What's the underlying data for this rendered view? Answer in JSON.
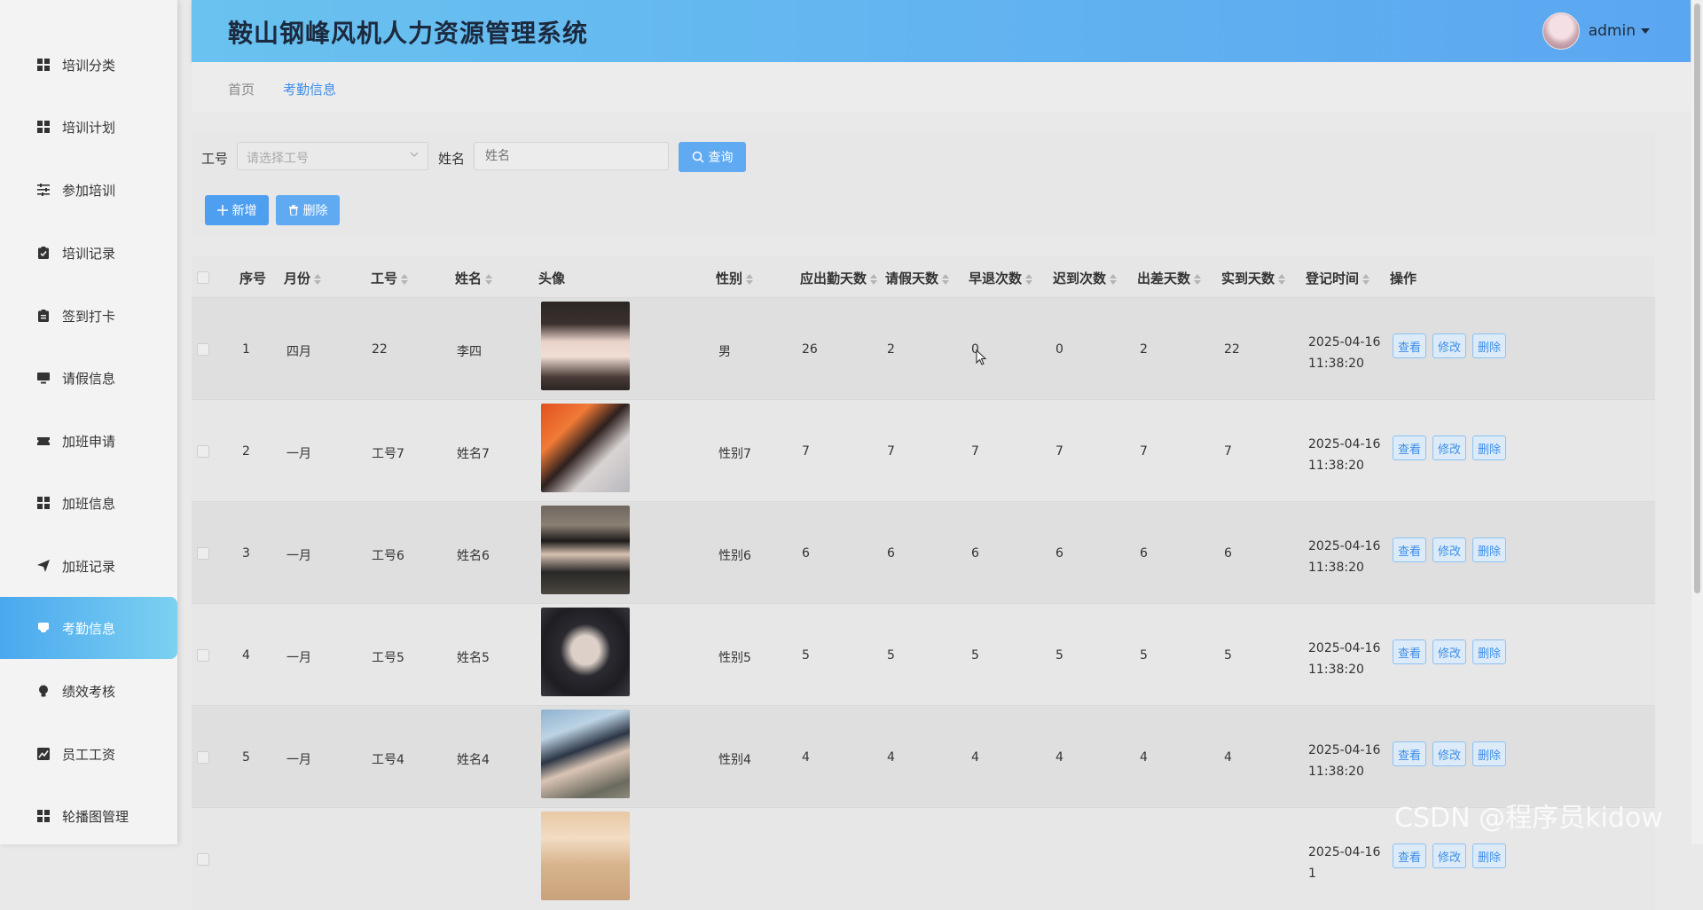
{
  "app": {
    "title": "鞍山钢峰风机人力资源管理系统",
    "username": "admin"
  },
  "sidebar": {
    "items": [
      {
        "label": "培训分类",
        "icon": "grid-icon"
      },
      {
        "label": "培训计划",
        "icon": "grid-icon"
      },
      {
        "label": "参加培训",
        "icon": "sliders-icon"
      },
      {
        "label": "培训记录",
        "icon": "clipboard-check-icon"
      },
      {
        "label": "签到打卡",
        "icon": "clipboard-icon"
      },
      {
        "label": "请假信息",
        "icon": "monitor-icon"
      },
      {
        "label": "加班申请",
        "icon": "ticket-icon"
      },
      {
        "label": "加班信息",
        "icon": "grid-icon"
      },
      {
        "label": "加班记录",
        "icon": "send-icon"
      },
      {
        "label": "考勤信息",
        "icon": "message-icon",
        "active": true
      },
      {
        "label": "绩效考核",
        "icon": "bulb-icon"
      },
      {
        "label": "员工工资",
        "icon": "chart-icon"
      },
      {
        "label": "轮播图管理",
        "icon": "grid-icon"
      }
    ]
  },
  "breadcrumb": {
    "home": "首页",
    "current": "考勤信息"
  },
  "search": {
    "gonghao_label": "工号",
    "gonghao_placeholder": "请选择工号",
    "xingming_label": "姓名",
    "xingming_placeholder": "姓名",
    "query_label": "查询",
    "add_label": "新增",
    "delete_label": "删除"
  },
  "table": {
    "headers": {
      "seq": "序号",
      "month": "月份",
      "gonghao": "工号",
      "name": "姓名",
      "photo": "头像",
      "gender": "性别",
      "due_days": "应出勤天数",
      "leave_days": "请假天数",
      "early_leave": "早退次数",
      "late": "迟到次数",
      "trip_days": "出差天数",
      "actual_days": "实到天数",
      "reg_time": "登记时间",
      "ops": "操作"
    },
    "ops": {
      "view": "查看",
      "edit": "修改",
      "delete": "删除"
    },
    "rows": [
      {
        "seq": "1",
        "month": "四月",
        "gonghao": "22",
        "name": "李四",
        "gender": "男",
        "due": "26",
        "leave": "2",
        "early": "0",
        "late": "0",
        "trip": "2",
        "actual": "22",
        "time": "2025-04-16 11:38:20"
      },
      {
        "seq": "2",
        "month": "一月",
        "gonghao": "工号7",
        "name": "姓名7",
        "gender": "性别7",
        "due": "7",
        "leave": "7",
        "early": "7",
        "late": "7",
        "trip": "7",
        "actual": "7",
        "time": "2025-04-16 11:38:20"
      },
      {
        "seq": "3",
        "month": "一月",
        "gonghao": "工号6",
        "name": "姓名6",
        "gender": "性别6",
        "due": "6",
        "leave": "6",
        "early": "6",
        "late": "6",
        "trip": "6",
        "actual": "6",
        "time": "2025-04-16 11:38:20"
      },
      {
        "seq": "4",
        "month": "一月",
        "gonghao": "工号5",
        "name": "姓名5",
        "gender": "性别5",
        "due": "5",
        "leave": "5",
        "early": "5",
        "late": "5",
        "trip": "5",
        "actual": "5",
        "time": "2025-04-16 11:38:20"
      },
      {
        "seq": "5",
        "month": "一月",
        "gonghao": "工号4",
        "name": "姓名4",
        "gender": "性别4",
        "due": "4",
        "leave": "4",
        "early": "4",
        "late": "4",
        "trip": "4",
        "actual": "4",
        "time": "2025-04-16 11:38:20"
      },
      {
        "seq": "",
        "month": "",
        "gonghao": "",
        "name": "",
        "gender": "",
        "due": "",
        "leave": "",
        "early": "",
        "late": "",
        "trip": "",
        "actual": "",
        "time": "2025-04-16 1"
      }
    ]
  },
  "watermark": "CSDN @程序员kidow",
  "colors": {
    "accent": "#4e9ff0",
    "header_start": "#69c2ef",
    "header_end": "#5ba6f1"
  }
}
